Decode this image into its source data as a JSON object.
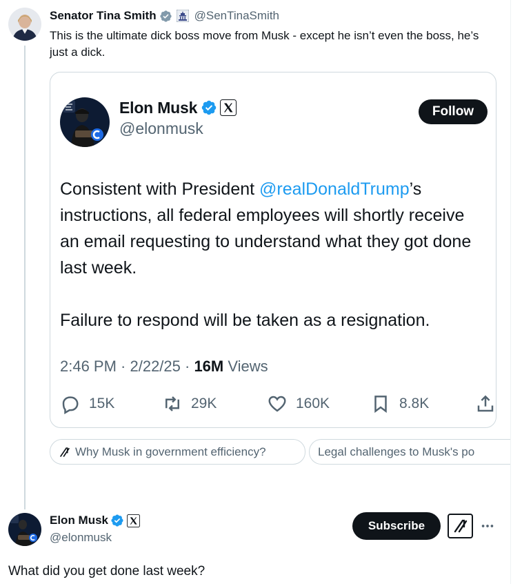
{
  "tweet": {
    "author_name": "Senator Tina Smith",
    "author_handle": "@SenTinaSmith",
    "text": "This is the ultimate dick boss move from Musk - except he isn’t even the boss, he’s just a dick."
  },
  "embedded_post": {
    "author_name": "Elon Musk",
    "author_handle": "@elonmusk",
    "follow_label": "Follow",
    "body_prefix": "Consistent with President ",
    "mention": "@realDonaldTrump",
    "body_suffix": "’s instructions, all federal employees will shortly receive an email requesting to understand what they got done last week.",
    "body_second": "Failure to respond will be taken as a resignation.",
    "time": "2:46 PM · 2/22/25 · ",
    "views_count": "16M",
    "views_label": " Views",
    "replies": "15K",
    "reposts": "29K",
    "likes": "160K",
    "bookmarks": "8.8K"
  },
  "chips": [
    "Why Musk in government efficiency?",
    "Legal challenges to Musk's po"
  ],
  "reply": {
    "author_name": "Elon Musk",
    "author_handle": "@elonmusk",
    "subscribe_label": "Subscribe",
    "text": "What did you get done last week?"
  },
  "icons": {
    "verified_gray": "verified-gray-icon",
    "government": "government-label-icon",
    "verified_blue": "verified-blue-icon",
    "x_logo": "x-logo-icon",
    "grok": "grok-icon"
  },
  "colors": {
    "link": "#1d9bf0",
    "text": "#0f1419",
    "muted": "#536471",
    "border": "#cfd9de"
  }
}
